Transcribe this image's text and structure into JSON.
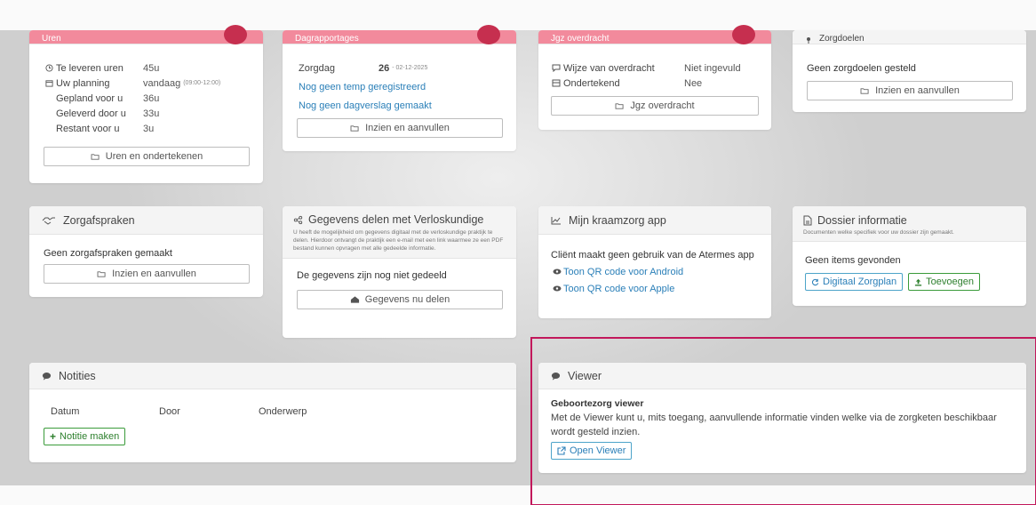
{
  "uren": {
    "title": "Uren",
    "te_leveren_label": "Te leveren uren",
    "te_leveren_value": "45u",
    "planning_label": "Uw planning",
    "planning_value": "vandaag",
    "planning_time": "(09:00-12:00)",
    "gepland_label": "Gepland voor u",
    "gepland_value": "36u",
    "geleverd_label": "Geleverd door u",
    "geleverd_value": "33u",
    "restant_label": "Restant voor u",
    "restant_value": "3u",
    "button": "Uren en ondertekenen"
  },
  "dagrapportages": {
    "title": "Dagrapportages",
    "zorgdag_label": "Zorgdag",
    "zorgdag_number": "26",
    "zorgdag_date": "- 02-12-2025",
    "temp_link": "Nog geen temp geregistreerd",
    "dagverslag_link": "Nog geen dagverslag gemaakt",
    "button": "Inzien en aanvullen"
  },
  "jgz": {
    "title": "Jgz overdracht",
    "wijze_label": "Wijze van overdracht",
    "wijze_value": "Niet ingevuld",
    "ondertekend_label": "Ondertekend",
    "ondertekend_value": "Nee",
    "button": "Jgz overdracht"
  },
  "zorgdoelen": {
    "title": "Zorgdoelen",
    "empty": "Geen zorgdoelen gesteld",
    "button": "Inzien en aanvullen"
  },
  "zorgafspraken": {
    "title": "Zorgafspraken",
    "empty": "Geen zorgafspraken gemaakt",
    "button": "Inzien en aanvullen"
  },
  "verloskundige": {
    "title": "Gegevens delen met Verloskundige",
    "description": "U heeft de mogelijkheid om gegevens digitaal met de verloskundige praktijk te delen. Hierdoor ontvangt de praktijk een e-mail met een link waarmee ze een PDF bestand kunnen opvragen met alle gedeelde informatie.",
    "status": "De gegevens zijn nog niet gedeeld",
    "button": "Gegevens nu delen"
  },
  "app": {
    "title": "Mijn kraamzorg app",
    "status": "Cliënt maakt geen gebruik van de Atermes app",
    "android_link": "Toon QR code voor Android",
    "apple_link": "Toon QR code voor Apple"
  },
  "dossier": {
    "title": "Dossier informatie",
    "subtitle": "Documenten welke specifiek voor uw dossier zijn gemaakt.",
    "empty": "Geen items gevonden",
    "digitaal_button": "Digitaal Zorgplan",
    "toevoegen_button": "Toevoegen"
  },
  "notities": {
    "title": "Notities",
    "columns": [
      "Datum",
      "Door",
      "Onderwerp"
    ],
    "button": "Notitie maken"
  },
  "viewer": {
    "title": "Viewer",
    "heading": "Geboortezorg viewer",
    "text": "Met de Viewer kunt u, mits toegang, aanvullende informatie vinden welke via de zorgketen beschikbaar wordt gesteld inzien.",
    "button": "Open Viewer"
  },
  "colors": {
    "accent_pink": "#f28a9c",
    "link_blue": "#2a7fb8",
    "green": "#2d7f2d",
    "highlight": "#c2185b"
  }
}
